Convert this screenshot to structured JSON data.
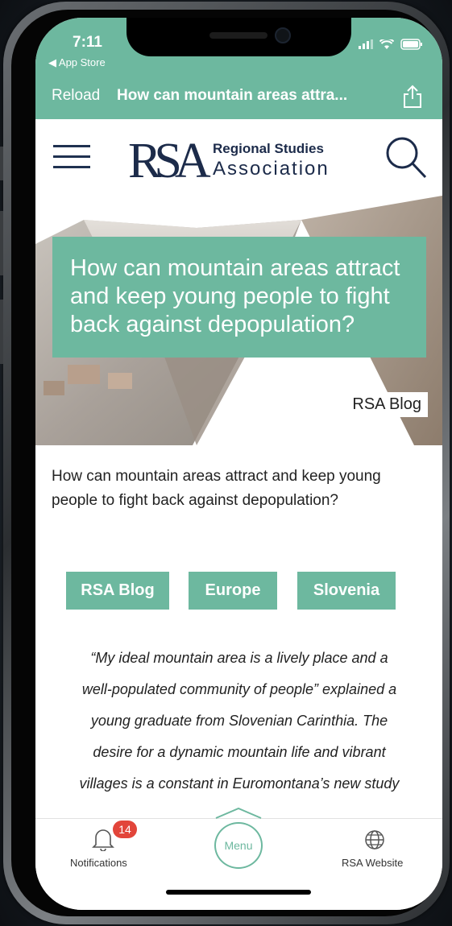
{
  "status_bar": {
    "time": "7:11",
    "back_app": "◀ App Store"
  },
  "nav_bar": {
    "reload_label": "Reload",
    "title": "How can mountain areas attra...",
    "share_icon": "share-icon"
  },
  "site_header": {
    "menu_icon": "hamburger-icon",
    "logo_mark": "RSA",
    "logo_line1": "Regional Studies",
    "logo_line2": "Association",
    "search_icon": "search-icon"
  },
  "hero": {
    "title": "How can mountain areas attract and keep young people to fight back against depopulation?",
    "tag": "RSA Blog"
  },
  "article": {
    "intro": "How can mountain areas attract and keep young people to fight back against depopulation?",
    "tags": [
      "RSA Blog",
      "Europe",
      "Slovenia"
    ],
    "quote_lines": [
      "“My ideal mountain area is a lively place and a",
      "well-populated community of people” explained a",
      "young graduate from Slovenian Carinthia. The",
      "desire for a dynamic mountain life and vibrant",
      "villages is a constant in Euromontana’s new study"
    ]
  },
  "bottom_bar": {
    "notifications_label": "Notifications",
    "notifications_count": "14",
    "menu_label": "Menu",
    "website_label": "RSA Website"
  },
  "colors": {
    "accent": "#6db89f",
    "navy": "#1c2b4a",
    "badge": "#e2453a"
  }
}
